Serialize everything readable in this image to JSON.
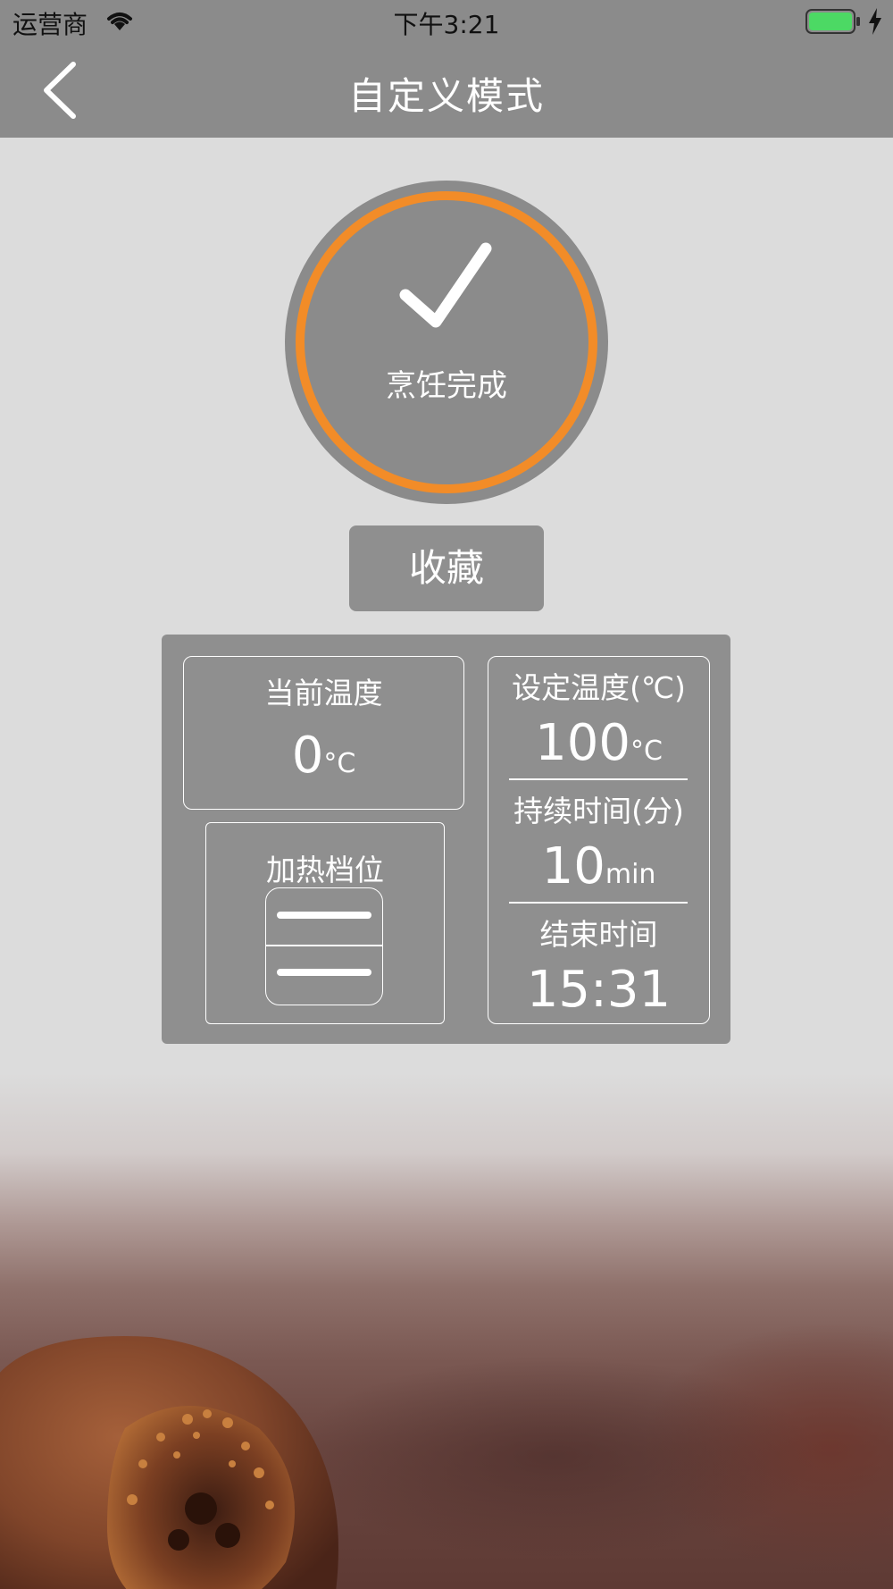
{
  "status_bar": {
    "carrier": "运营商",
    "time": "下午3:21",
    "battery_color": "#4cd964"
  },
  "nav": {
    "back_icon": "chevron-left-icon",
    "title": "自定义模式"
  },
  "status_ring": {
    "icon": "checkmark-icon",
    "label": "烹饪完成",
    "ring_color": "#f28c28"
  },
  "favorite_button": {
    "label": "收藏"
  },
  "current_temp": {
    "label": "当前温度",
    "value": "0",
    "unit": "°C"
  },
  "heat_level": {
    "label": "加热档位",
    "icon": "heat-level-icon"
  },
  "set_temp": {
    "label": "设定温度(℃)",
    "value": "100",
    "unit": "°C"
  },
  "duration": {
    "label": "持续时间(分)",
    "value": "10",
    "unit": "min"
  },
  "end_time": {
    "label": "结束时间",
    "value": "15:31"
  },
  "colors": {
    "header_bg": "#8b8b8b",
    "page_bg": "#dcdcdc",
    "panel_bg": "#8f8f8f",
    "accent": "#f28c28"
  }
}
